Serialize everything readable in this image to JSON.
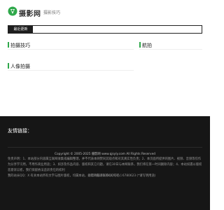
{
  "header": {
    "logo_text": "摄影网",
    "nav_link": "摄影技巧",
    "brand_color": "#2ea84a",
    "logo_icon": "camera-leaf-icon"
  },
  "latest": {
    "label": "最近更新"
  },
  "sections": [
    {
      "title": "拍摄技巧"
    },
    {
      "title": "航拍"
    },
    {
      "title": "人像拍摄"
    }
  ],
  "footer": {
    "friend_links": "友情链接：",
    "copyright": "Copyright © 2005-2025 摄影网 www.qjsyly.com All Rights Reserved",
    "disclaimer_line1": "免责声明：1、本站部分内容属互联网收集或编辑整理，并不代表本网赞同其观点和对其真实性负责；2、本页面所提供的图片、视频、音频等仅作为分享学习用，不用作商业用途；3、如涉及作品内容、版权和其它问题，请在30日与本网联系，我们将在第一时间删除内容；4、本站如遇以版权恶意诉讼者，我们保留依法追诉责任的权利",
    "disclaimer_line2": "我的站长QQ：X 有关本站所有文字与图片版权，均属本站，如需转载请联系QQ号码：6780623 (*请写明用途)",
    "icp": "备ICP备202300020号-1"
  }
}
